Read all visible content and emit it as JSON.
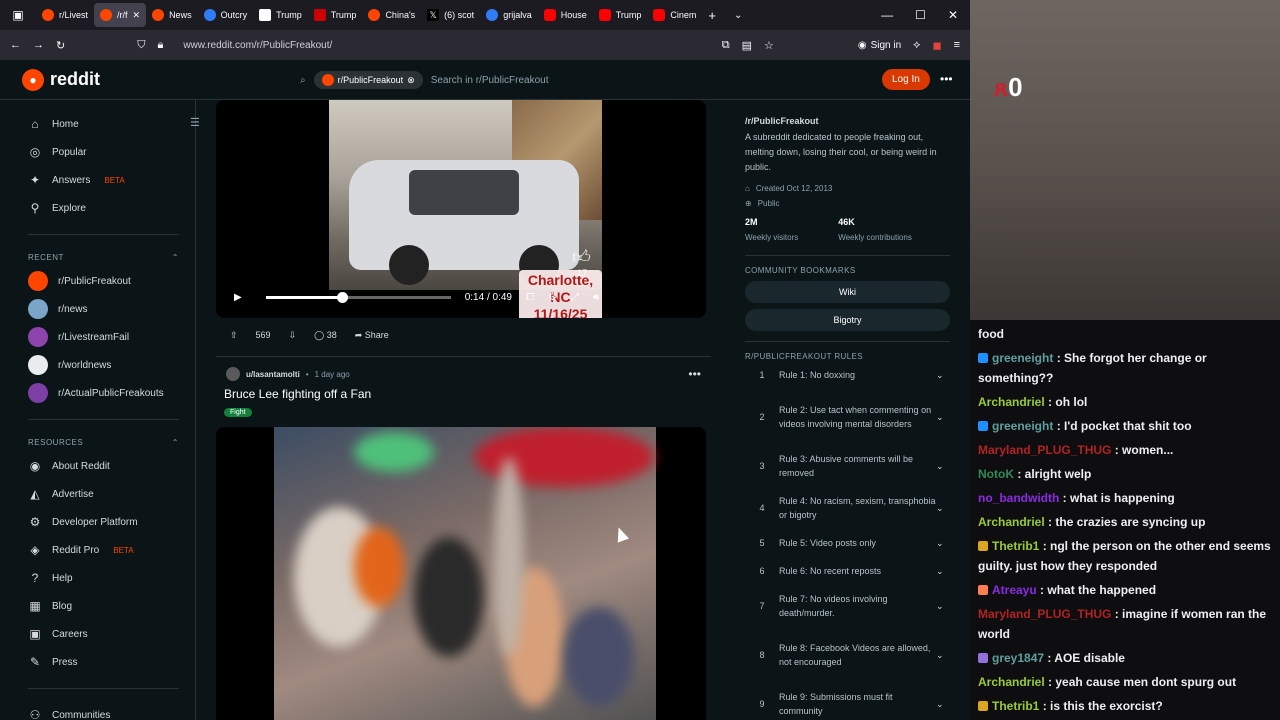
{
  "browser": {
    "tabs": [
      {
        "label": "r/Livest",
        "icon": "red"
      },
      {
        "label": "/r/f",
        "icon": "red",
        "active": true
      },
      {
        "label": "News",
        "icon": "red"
      },
      {
        "label": "Outcry",
        "icon": "g"
      },
      {
        "label": "Trump",
        "icon": "ap"
      },
      {
        "label": "Trump",
        "icon": "cnn"
      },
      {
        "label": "China's",
        "icon": "red"
      },
      {
        "label": "(6) scot",
        "icon": "x"
      },
      {
        "label": "grijalva",
        "icon": "g"
      },
      {
        "label": "House",
        "icon": "yt"
      },
      {
        "label": "Trump",
        "icon": "yt"
      },
      {
        "label": "Cinem",
        "icon": "yt"
      }
    ],
    "url": "www.reddit.com/r/PublicFreakout/",
    "signin_label": "Sign in"
  },
  "reddit_header": {
    "logo_text": "reddit",
    "subreddit_chip": "r/PublicFreakout",
    "search_placeholder": "Search in r/PublicFreakout",
    "login_label": "Log In"
  },
  "left_nav": {
    "main": [
      {
        "label": "Home",
        "icon": "home-icon"
      },
      {
        "label": "Popular",
        "icon": "popular-icon"
      },
      {
        "label": "Answers",
        "icon": "answers-icon",
        "badge": "BETA"
      },
      {
        "label": "Explore",
        "icon": "explore-icon"
      }
    ],
    "recent_header": "RECENT",
    "recent": [
      {
        "label": "r/PublicFreakout",
        "color": "#ff4500"
      },
      {
        "label": "r/news",
        "color": "#7aa5c9"
      },
      {
        "label": "r/LivestreamFail",
        "color": "#8e44ad"
      },
      {
        "label": "r/worldnews",
        "color": "#e9ecef"
      },
      {
        "label": "r/ActualPublicFreakouts",
        "color": "#7b3fa6"
      }
    ],
    "resources_header": "RESOURCES",
    "resources": [
      {
        "label": "About Reddit",
        "icon": "reddit-icon"
      },
      {
        "label": "Advertise",
        "icon": "megaphone-icon"
      },
      {
        "label": "Developer Platform",
        "icon": "developer-icon"
      },
      {
        "label": "Reddit Pro",
        "icon": "reddit-pro-icon",
        "badge": "BETA"
      },
      {
        "label": "Help",
        "icon": "help-icon"
      },
      {
        "label": "Blog",
        "icon": "blog-icon"
      },
      {
        "label": "Careers",
        "icon": "careers-icon"
      },
      {
        "label": "Press",
        "icon": "press-icon"
      }
    ],
    "communities_label": "Communities"
  },
  "post1": {
    "video_caption_line1": "Charlotte, NC",
    "video_caption_line2": "11/16/25",
    "like_count": "17",
    "time": "0:14 / 0:49",
    "progress": 0.41,
    "upvotes": "569",
    "comments": "38",
    "share_label": "Share"
  },
  "post2": {
    "author": "u/lasantamolti",
    "age": "1 day ago",
    "title": "Bruce Lee fighting off a Fan",
    "flair": "Fight"
  },
  "right_sidebar": {
    "title": "/r/PublicFreakout",
    "description": "A subreddit dedicated to people freaking out, melting down, losing their cool, or being weird in public.",
    "created": "Created Oct 12, 2013",
    "visibility": "Public",
    "visitors_value": "2M",
    "visitors_label": "Weekly visitors",
    "contrib_value": "46K",
    "contrib_label": "Weekly contributions",
    "bookmarks_header": "COMMUNITY BOOKMARKS",
    "bookmarks": [
      "Wiki",
      "Bigotry"
    ],
    "rules_header": "R/PUBLICFREAKOUT RULES",
    "rules": [
      {
        "num": "1",
        "text": "Rule 1: No doxxing"
      },
      {
        "num": "2",
        "text": "Rule 2: Use tact when commenting on videos involving mental disorders"
      },
      {
        "num": "3",
        "text": "Rule 3: Abusive comments will be removed"
      },
      {
        "num": "4",
        "text": "Rule 4: No racism, sexism, transphobia or bigotry"
      },
      {
        "num": "5",
        "text": "Rule 5: Video posts only"
      },
      {
        "num": "6",
        "text": "Rule 6: No recent reposts"
      },
      {
        "num": "7",
        "text": "Rule 7: No videos involving death/murder."
      },
      {
        "num": "8",
        "text": "Rule 8: Facebook Videos are allowed, not encouraged"
      },
      {
        "num": "9",
        "text": "Rule 9: Submissions must fit community"
      }
    ]
  },
  "stream": {
    "badge_count": "0"
  },
  "chat": {
    "messages": [
      {
        "user": "",
        "text": "food",
        "color": "#efeff1"
      },
      {
        "user": "greeneight",
        "text": ": She forgot her change or something??",
        "color": "#5f9ea0",
        "badge": "#1e90ff"
      },
      {
        "user": "Archandriel",
        "text": ": oh lol",
        "color": "#9acd32"
      },
      {
        "user": "greeneight",
        "text": ": I'd pocket that shit too",
        "color": "#5f9ea0",
        "badge": "#1e90ff"
      },
      {
        "user": "Maryland_PLUG_THUG",
        "text": ": women...",
        "color": "#b22222"
      },
      {
        "user": "NotoK",
        "text": ": alright welp",
        "color": "#2e8b57"
      },
      {
        "user": "no_bandwidth",
        "text": ": what is happening",
        "color": "#8a2be2"
      },
      {
        "user": "Archandriel",
        "text": ": the crazies are syncing up",
        "color": "#9acd32"
      },
      {
        "user": "Thetrib1",
        "text": ": ngl the person on the other end seems guilty. just how they responded",
        "color": "#9acd32",
        "badge": "#daa520"
      },
      {
        "user": "Atreayu",
        "text": ": what the happened",
        "color": "#8a2be2",
        "badge": "#ff7f50"
      },
      {
        "user": "Maryland_PLUG_THUG",
        "text": ": imagine if women ran the world",
        "color": "#b22222"
      },
      {
        "user": "grey1847",
        "text": ": AOE disable",
        "color": "#5f9ea0",
        "badge": "#9370db"
      },
      {
        "user": "Archandriel",
        "text": ": yeah cause men dont spurg out",
        "color": "#9acd32"
      },
      {
        "user": "Thetrib1",
        "text": ": is this the exorcist?",
        "color": "#9acd32",
        "badge": "#daa520"
      }
    ]
  }
}
